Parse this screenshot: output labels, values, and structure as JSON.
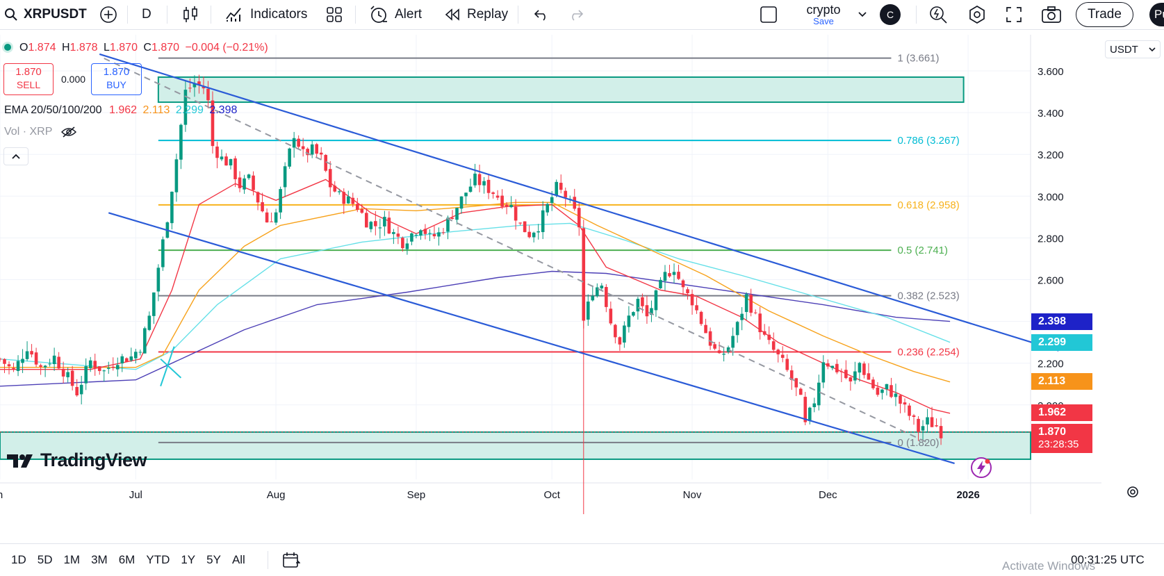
{
  "toolbar": {
    "symbol": "XRPUSDT",
    "interval": "D",
    "indicators_label": "Indicators",
    "alert_label": "Alert",
    "replay_label": "Replay",
    "layout_name": "crypto",
    "layout_status": "Save",
    "avatar_letter": "C",
    "trade_label": "Trade",
    "publish_partial": "Pu"
  },
  "legend": {
    "open_label": "O",
    "open": "1.874",
    "high_label": "H",
    "high": "1.878",
    "low_label": "L",
    "low": "1.870",
    "close_label": "C",
    "close": "1.870",
    "change": "−0.004 (−0.21%)",
    "sell_price": "1.870",
    "sell_label": "SELL",
    "spread": "0.000",
    "buy_price": "1.870",
    "buy_label": "BUY",
    "ema_label": "EMA 20/50/100/200",
    "ema20": "1.962",
    "ema50": "2.113",
    "ema100": "2.299",
    "ema200": "2.398",
    "vol_label": "Vol · XRP"
  },
  "currency": "USDT",
  "colors": {
    "up": "#089981",
    "down": "#f23645",
    "ema20": "#f23645",
    "ema50": "#f7a21b",
    "ema100": "#66e0e8",
    "ema200": "#4c3fb6",
    "channel": "#2a5bd7",
    "zone": "#d2efe9",
    "zone_border": "#089981"
  },
  "timeframes": [
    "1D",
    "5D",
    "1M",
    "3M",
    "6M",
    "YTD",
    "1Y",
    "5Y",
    "All"
  ],
  "clock": "00:31:25 UTC",
  "os_watermark": "Activate Windows",
  "brand": "TradingView",
  "countdown": "23:28:35",
  "chart_data": {
    "type": "candlestick",
    "symbol": "XRPUSDT",
    "interval": "D",
    "ylim": [
      1.74,
      3.71
    ],
    "y_ticks": [
      "2.000",
      "2.200",
      "2.400",
      "2.600",
      "2.800",
      "3.000",
      "3.200",
      "3.400",
      "3.600"
    ],
    "x_ticks": [
      {
        "label": "n",
        "day": 0
      },
      {
        "label": "Jul",
        "day": 30
      },
      {
        "label": "Aug",
        "day": 61
      },
      {
        "label": "Sep",
        "day": 92
      },
      {
        "label": "Oct",
        "day": 122
      },
      {
        "label": "Nov",
        "day": 153
      },
      {
        "label": "Dec",
        "day": 183
      },
      {
        "label": "2026",
        "day": 214
      }
    ],
    "fib_levels": [
      {
        "ratio": "1",
        "price": 3.661,
        "label": "1 (3.661)",
        "color": "#787b86"
      },
      {
        "ratio": "0.786",
        "price": 3.267,
        "label": "0.786 (3.267)",
        "color": "#00bcd4"
      },
      {
        "ratio": "0.618",
        "price": 2.958,
        "label": "0.618 (2.958)",
        "color": "#f7b21b"
      },
      {
        "ratio": "0.5",
        "price": 2.741,
        "label": "0.5 (2.741)",
        "color": "#4caf50"
      },
      {
        "ratio": "0.382",
        "price": 2.523,
        "label": "0.382 (2.523)",
        "color": "#787b86"
      },
      {
        "ratio": "0.236",
        "price": 2.254,
        "label": "0.236 (2.254)",
        "color": "#f23645"
      },
      {
        "ratio": "0",
        "price": 1.82,
        "label": "0 (1.820)",
        "color": "#787b86"
      }
    ],
    "price_labels": [
      {
        "name": "ema200",
        "value": "2.398",
        "price": 2.398,
        "color": "#1e22c8"
      },
      {
        "name": "ema100",
        "value": "2.299",
        "price": 2.299,
        "color": "#22c7d6"
      },
      {
        "name": "ema50",
        "value": "2.113",
        "price": 2.113,
        "color": "#f7931a"
      },
      {
        "name": "ema20",
        "value": "1.962",
        "price": 1.962,
        "color": "#f23645"
      },
      {
        "name": "last",
        "value": "1.870",
        "price": 1.87,
        "color": "#f23645"
      }
    ],
    "ohlc_path": [
      [
        0,
        2.22
      ],
      [
        3,
        2.16
      ],
      [
        6,
        2.28
      ],
      [
        9,
        2.18
      ],
      [
        12,
        2.23
      ],
      [
        15,
        2.13
      ],
      [
        17,
        2.06
      ],
      [
        20,
        2.21
      ],
      [
        23,
        2.16
      ],
      [
        26,
        2.22
      ],
      [
        29,
        2.23
      ],
      [
        31,
        2.28
      ],
      [
        33,
        2.42
      ],
      [
        35,
        2.66
      ],
      [
        37,
        2.9
      ],
      [
        39,
        3.18
      ],
      [
        41,
        3.5
      ],
      [
        43,
        3.54
      ],
      [
        45,
        3.52
      ],
      [
        46,
        3.45
      ],
      [
        47,
        3.24
      ],
      [
        49,
        3.18
      ],
      [
        51,
        3.15
      ],
      [
        53,
        3.05
      ],
      [
        55,
        3.08
      ],
      [
        57,
        2.98
      ],
      [
        59,
        2.88
      ],
      [
        61,
        2.92
      ],
      [
        63,
        3.12
      ],
      [
        65,
        3.3
      ],
      [
        67,
        3.2
      ],
      [
        69,
        3.22
      ],
      [
        71,
        3.18
      ],
      [
        73,
        3.05
      ],
      [
        75,
        3.0
      ],
      [
        77,
        2.98
      ],
      [
        79,
        2.95
      ],
      [
        81,
        2.88
      ],
      [
        83,
        2.86
      ],
      [
        85,
        2.88
      ],
      [
        87,
        2.82
      ],
      [
        89,
        2.78
      ],
      [
        91,
        2.82
      ],
      [
        93,
        2.86
      ],
      [
        95,
        2.8
      ],
      [
        97,
        2.82
      ],
      [
        99,
        2.88
      ],
      [
        101,
        2.95
      ],
      [
        103,
        3.02
      ],
      [
        105,
        3.08
      ],
      [
        107,
        3.05
      ],
      [
        109,
        3.02
      ],
      [
        111,
        2.98
      ],
      [
        113,
        2.95
      ],
      [
        115,
        2.86
      ],
      [
        117,
        2.82
      ],
      [
        119,
        2.86
      ],
      [
        121,
        2.95
      ],
      [
        123,
        3.04
      ],
      [
        125,
        3.0
      ],
      [
        127,
        2.92
      ],
      [
        128,
        2.86
      ],
      [
        129,
        2.4
      ],
      [
        131,
        2.55
      ],
      [
        133,
        2.58
      ],
      [
        135,
        2.4
      ],
      [
        137,
        2.3
      ],
      [
        139,
        2.42
      ],
      [
        141,
        2.5
      ],
      [
        143,
        2.42
      ],
      [
        145,
        2.52
      ],
      [
        147,
        2.62
      ],
      [
        149,
        2.66
      ],
      [
        151,
        2.55
      ],
      [
        153,
        2.5
      ],
      [
        155,
        2.4
      ],
      [
        157,
        2.3
      ],
      [
        159,
        2.22
      ],
      [
        161,
        2.28
      ],
      [
        163,
        2.38
      ],
      [
        165,
        2.52
      ],
      [
        167,
        2.42
      ],
      [
        169,
        2.32
      ],
      [
        171,
        2.26
      ],
      [
        173,
        2.2
      ],
      [
        175,
        2.12
      ],
      [
        177,
        2.02
      ],
      [
        178,
        1.9
      ],
      [
        180,
        2.02
      ],
      [
        182,
        2.22
      ],
      [
        184,
        2.18
      ],
      [
        186,
        2.16
      ],
      [
        188,
        2.1
      ],
      [
        190,
        2.2
      ],
      [
        192,
        2.12
      ],
      [
        194,
        2.05
      ],
      [
        196,
        2.08
      ],
      [
        198,
        2.04
      ],
      [
        200,
        1.98
      ],
      [
        202,
        1.92
      ],
      [
        203,
        1.88
      ],
      [
        205,
        1.92
      ],
      [
        207,
        1.9
      ],
      [
        208,
        1.87
      ]
    ],
    "ema20": [
      [
        0,
        2.17
      ],
      [
        20,
        2.17
      ],
      [
        31,
        2.22
      ],
      [
        38,
        2.55
      ],
      [
        44,
        2.96
      ],
      [
        52,
        3.06
      ],
      [
        61,
        2.98
      ],
      [
        72,
        3.08
      ],
      [
        82,
        2.92
      ],
      [
        92,
        2.82
      ],
      [
        102,
        2.92
      ],
      [
        112,
        2.95
      ],
      [
        122,
        2.96
      ],
      [
        128,
        2.86
      ],
      [
        134,
        2.66
      ],
      [
        146,
        2.55
      ],
      [
        154,
        2.52
      ],
      [
        164,
        2.42
      ],
      [
        172,
        2.3
      ],
      [
        182,
        2.2
      ],
      [
        190,
        2.12
      ],
      [
        198,
        2.06
      ],
      [
        206,
        1.98
      ],
      [
        210,
        1.96
      ]
    ],
    "ema50": [
      [
        0,
        2.18
      ],
      [
        30,
        2.18
      ],
      [
        36,
        2.24
      ],
      [
        44,
        2.55
      ],
      [
        54,
        2.76
      ],
      [
        62,
        2.86
      ],
      [
        80,
        2.94
      ],
      [
        92,
        2.93
      ],
      [
        104,
        2.95
      ],
      [
        114,
        2.97
      ],
      [
        122,
        2.97
      ],
      [
        132,
        2.86
      ],
      [
        146,
        2.72
      ],
      [
        156,
        2.62
      ],
      [
        170,
        2.45
      ],
      [
        182,
        2.33
      ],
      [
        192,
        2.24
      ],
      [
        202,
        2.16
      ],
      [
        210,
        2.11
      ]
    ],
    "ema100": [
      [
        0,
        2.22
      ],
      [
        30,
        2.17
      ],
      [
        38,
        2.26
      ],
      [
        48,
        2.48
      ],
      [
        62,
        2.7
      ],
      [
        80,
        2.78
      ],
      [
        100,
        2.83
      ],
      [
        115,
        2.86
      ],
      [
        126,
        2.87
      ],
      [
        138,
        2.79
      ],
      [
        150,
        2.7
      ],
      [
        164,
        2.62
      ],
      [
        180,
        2.52
      ],
      [
        196,
        2.42
      ],
      [
        210,
        2.3
      ]
    ],
    "ema200": [
      [
        0,
        2.09
      ],
      [
        30,
        2.12
      ],
      [
        40,
        2.22
      ],
      [
        54,
        2.36
      ],
      [
        70,
        2.48
      ],
      [
        90,
        2.54
      ],
      [
        110,
        2.61
      ],
      [
        122,
        2.64
      ],
      [
        134,
        2.63
      ],
      [
        150,
        2.58
      ],
      [
        166,
        2.53
      ],
      [
        182,
        2.48
      ],
      [
        198,
        2.42
      ],
      [
        210,
        2.4
      ]
    ],
    "channel_upper": [
      [
        22,
        3.68
      ],
      [
        234,
        2.26
      ]
    ],
    "channel_lower": [
      [
        24,
        2.92
      ],
      [
        211,
        1.72
      ]
    ],
    "diagonal_dashed": [
      [
        23,
        3.66
      ],
      [
        205,
        1.82
      ]
    ],
    "supply_zone": {
      "from_day": 35,
      "to_day": 213,
      "top": 3.57,
      "bottom": 3.45
    },
    "demand_zone": {
      "top": 1.87,
      "bottom": 1.74
    }
  }
}
